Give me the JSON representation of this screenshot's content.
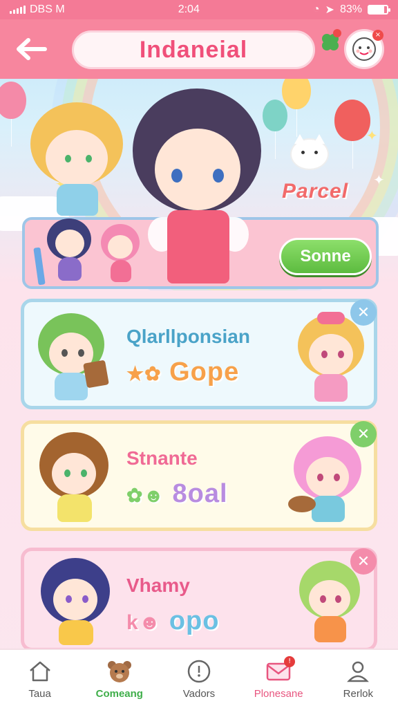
{
  "status_bar": {
    "carrier": "DBS M",
    "time": "2:04",
    "battery": "83%",
    "battery_level": 0.83
  },
  "header": {
    "title": "Indaneial",
    "back_icon": "back-arrow-icon",
    "clover_icon": "clover-icon",
    "avatar_icon": "avatar-face-icon"
  },
  "hero": {
    "tag": "Parcel",
    "play_label": "Sonne"
  },
  "cards": [
    {
      "title": "Qlarllponsian",
      "subtitle": "Gope",
      "prefix": "★✿"
    },
    {
      "title": "Stnante",
      "subtitle": "8oal",
      "prefix": "✿☻"
    },
    {
      "title": "Vhamy",
      "subtitle": "opo",
      "prefix": "k☻"
    }
  ],
  "bottom_nav": [
    {
      "label": "Taua",
      "icon": "home-icon"
    },
    {
      "label": "Comeang",
      "icon": "bear-icon"
    },
    {
      "label": "Vadors",
      "icon": "compass-icon"
    },
    {
      "label": "Plonesane",
      "icon": "mail-icon",
      "badge": "!"
    },
    {
      "label": "Rerlok",
      "icon": "profile-icon"
    }
  ],
  "colors": {
    "header": "#f7869e",
    "accent_pink": "#f0507a",
    "play_green": "#5cbb3f"
  }
}
